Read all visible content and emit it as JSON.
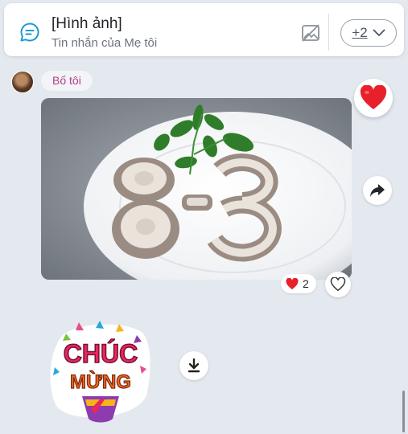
{
  "reply_bar": {
    "title": "[Hình ảnh]",
    "subtitle": "Tin nhắn của Mẹ tôi",
    "more_count": "+2",
    "icons": [
      "chat-bubble-icon",
      "image-off-icon",
      "chevron-down-icon"
    ]
  },
  "message": {
    "sender": "Bố tôi",
    "photo_text": "8-3",
    "reaction_emoji": "heart",
    "reaction_count": "2"
  },
  "sticker": {
    "line1": "CHÚC",
    "line2": "MỪNG"
  },
  "colors": {
    "background": "#e4e8ef",
    "sender_name": "#b23d8a",
    "heart": "#e8202a"
  }
}
